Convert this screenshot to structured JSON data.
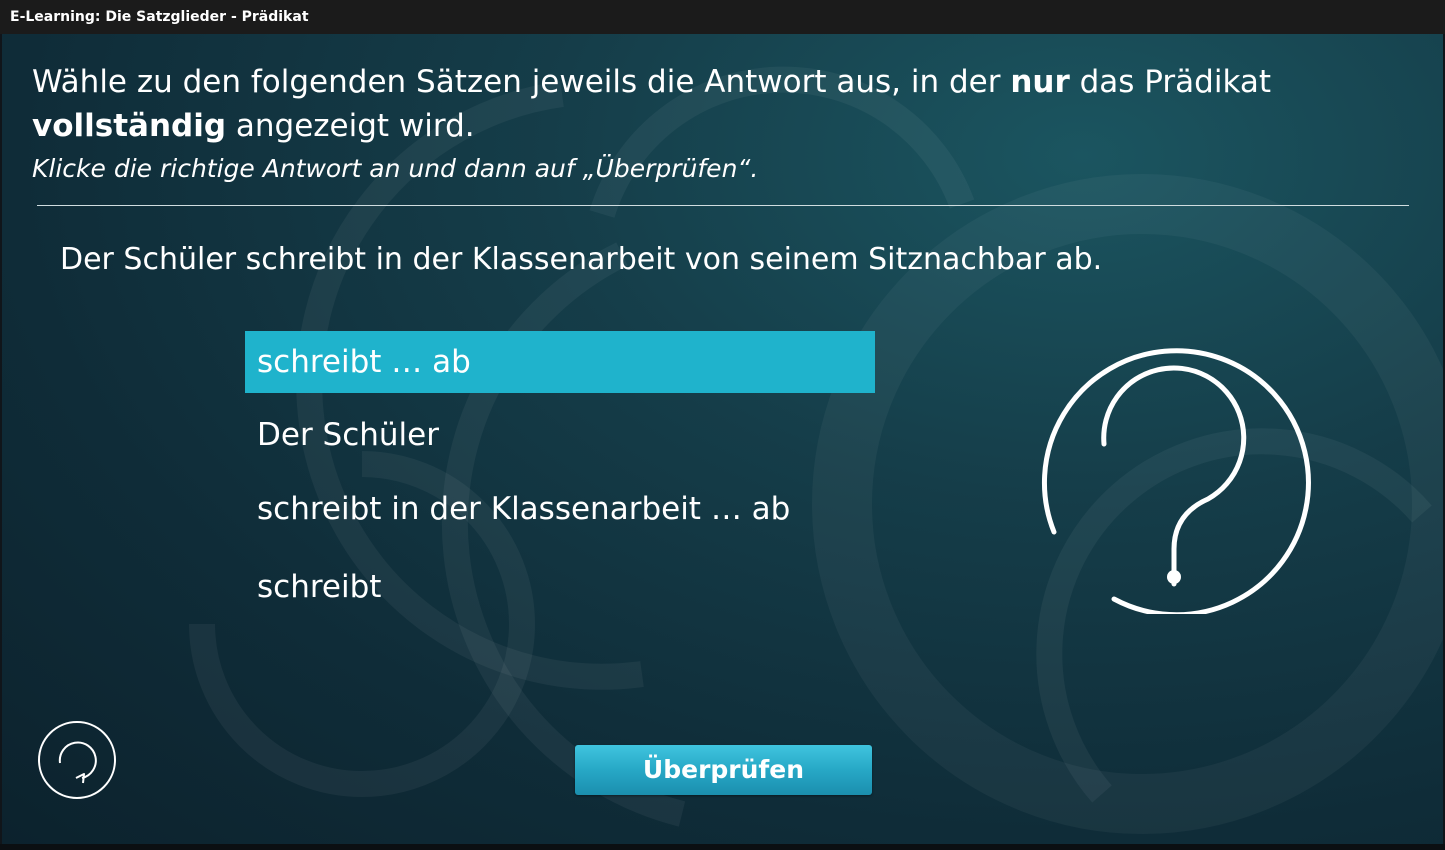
{
  "window": {
    "title": "E-Learning: Die Satzglieder - Prädikat"
  },
  "instruction": {
    "part1": "Wähle zu den folgenden Sätzen jeweils die Antwort aus, in der ",
    "bold1": "nur",
    "part2": " das Prädikat ",
    "bold2": "vollständig",
    "part3": " angezeigt wird.",
    "hint": "Klicke die richtige Antwort an und dann auf „Überprüfen“."
  },
  "question": {
    "sentence": "Der Schüler schreibt in der Klassenarbeit von seinem Sitznachbar ab."
  },
  "options": [
    {
      "label": "schreibt … ab",
      "selected": true
    },
    {
      "label": "Der Schüler",
      "selected": false
    },
    {
      "label": "schreibt in der Klassenarbeit … ab",
      "selected": false
    },
    {
      "label": "schreibt",
      "selected": false
    }
  ],
  "actions": {
    "check_label": "Überprüfen"
  },
  "icons": {
    "question": "question-mark-icon",
    "reset": "reset-icon"
  },
  "colors": {
    "accent": "#1fb3cc",
    "background": "#153d49",
    "text": "#ffffff"
  }
}
